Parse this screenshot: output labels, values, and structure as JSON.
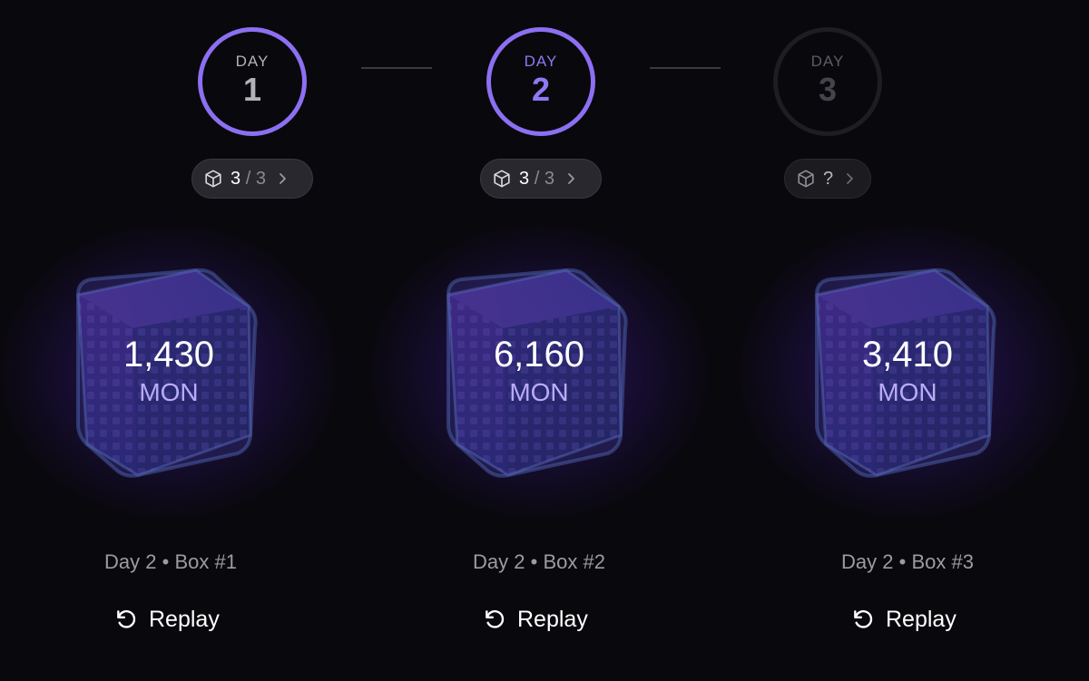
{
  "stepper": {
    "days": [
      {
        "label": "DAY",
        "number": "1",
        "state": "completed"
      },
      {
        "label": "DAY",
        "number": "2",
        "state": "current"
      },
      {
        "label": "DAY",
        "number": "3",
        "state": "locked"
      }
    ]
  },
  "pills": [
    {
      "icon": "box-icon",
      "opened": "3",
      "separator": "/",
      "total": "3",
      "chevron": "chevron-right-icon"
    },
    {
      "icon": "box-icon",
      "opened": "3",
      "separator": "/",
      "total": "3",
      "chevron": "chevron-right-icon"
    },
    {
      "icon": "box-icon",
      "opened": "?",
      "chevron": "chevron-right-icon"
    }
  ],
  "boxes": [
    {
      "amount": "1,430",
      "unit": "MON",
      "caption": "Day 2 • Box #1",
      "replay_label": "Replay",
      "replay_icon": "replay-icon"
    },
    {
      "amount": "6,160",
      "unit": "MON",
      "caption": "Day 2 • Box #2",
      "replay_label": "Replay",
      "replay_icon": "replay-icon"
    },
    {
      "amount": "3,410",
      "unit": "MON",
      "caption": "Day 2 • Box #3",
      "replay_label": "Replay",
      "replay_icon": "replay-icon"
    }
  ],
  "colors": {
    "background": "#09080c",
    "accent": "#8c6ff2",
    "currency": "#b9acf7",
    "muted_text": "#9c9ba1"
  }
}
